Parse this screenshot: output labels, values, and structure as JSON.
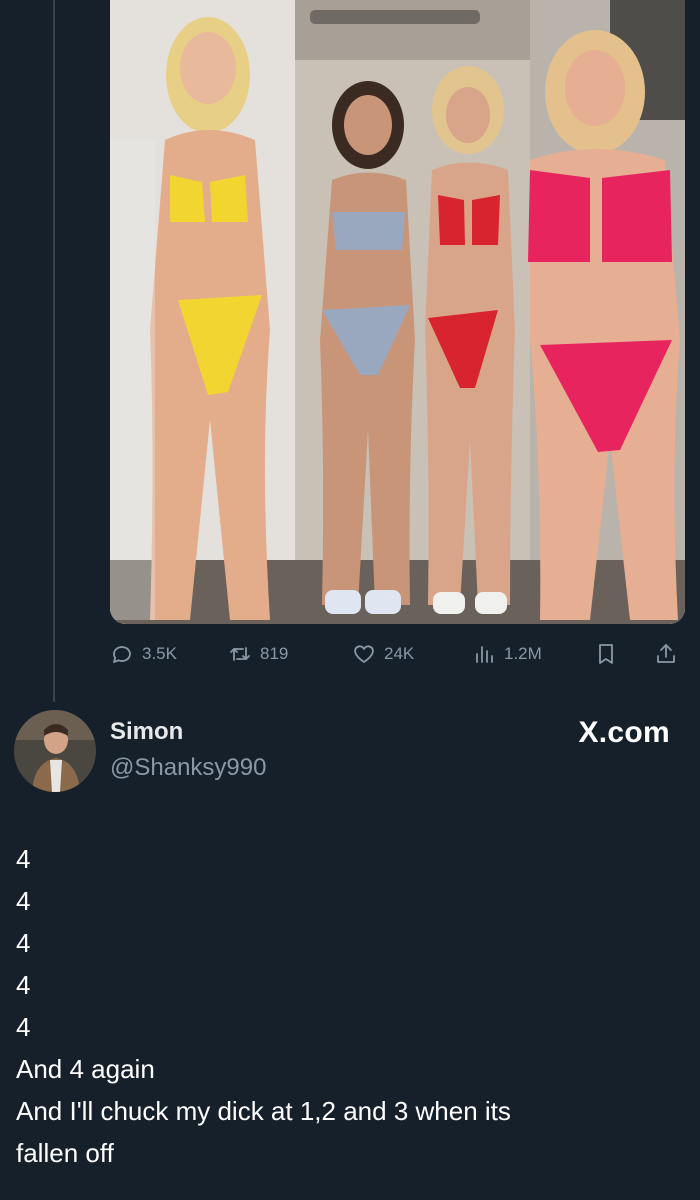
{
  "previous_post": {
    "media": {
      "icon": "photo",
      "description_colors": {
        "wall": "#d8d3cc",
        "bikini_yellow": "#f2d531",
        "bikini_grey": "#9aa8bf",
        "bikini_red": "#d8242e",
        "bikini_pink": "#e8245e"
      }
    },
    "actions": {
      "reply_count": "3.5K",
      "repost_count": "819",
      "like_count": "24K",
      "views_count": "1.2M"
    }
  },
  "post": {
    "author": {
      "name": "Simon",
      "handle": "@Shanksy990"
    },
    "site_tag": "X.com",
    "text_lines": [
      "4",
      "4",
      "4",
      "4",
      "4",
      "And 4 again",
      "And I'll chuck my dick at 1,2 and 3 when its",
      "fallen off"
    ]
  },
  "colors": {
    "background": "#15202b",
    "muted_text": "#8b98a5",
    "primary_text": "#ffffff",
    "thread_line": "#38444d"
  }
}
